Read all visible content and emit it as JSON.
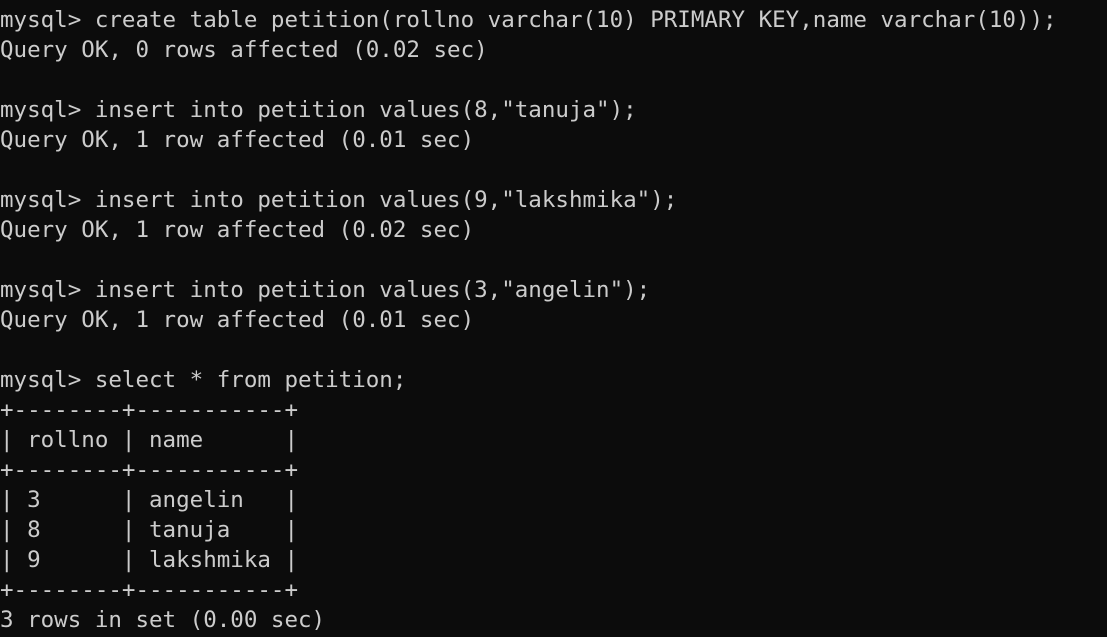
{
  "terminal": {
    "background": "#0c0c0c",
    "foreground": "#cccccc",
    "lines": [
      "mysql> create table petition(rollno varchar(10) PRIMARY KEY,name varchar(10));",
      "Query OK, 0 rows affected (0.02 sec)",
      "",
      "mysql> insert into petition values(8,\"tanuja\");",
      "Query OK, 1 row affected (0.01 sec)",
      "",
      "mysql> insert into petition values(9,\"lakshmika\");",
      "Query OK, 1 row affected (0.02 sec)",
      "",
      "mysql> insert into petition values(3,\"angelin\");",
      "Query OK, 1 row affected (0.01 sec)",
      "",
      "mysql> select * from petition;",
      "+--------+-----------+",
      "| rollno | name      |",
      "+--------+-----------+",
      "| 3      | angelin   |",
      "| 8      | tanuja    |",
      "| 9      | lakshmika |",
      "+--------+-----------+",
      "3 rows in set (0.00 sec)"
    ]
  }
}
